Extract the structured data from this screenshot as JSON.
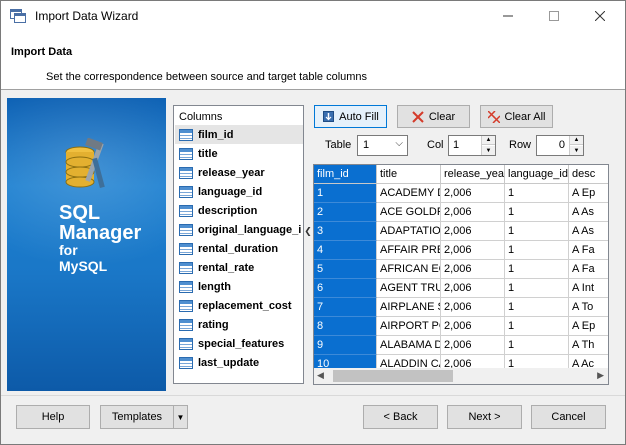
{
  "window": {
    "title": "Import Data Wizard",
    "minimize_icon": "minimize-icon",
    "maximize_icon": "maximize-icon",
    "close_icon": "close-icon"
  },
  "header": {
    "title": "Import Data",
    "subtitle": "Set the correspondence between source and target table columns"
  },
  "banner": {
    "line1": "SQL",
    "line2": "Manager",
    "line3": "for",
    "line4": "MySQL"
  },
  "columns": {
    "header": "Columns",
    "items": [
      "film_id",
      "title",
      "release_year",
      "language_id",
      "description",
      "original_language_i",
      "rental_duration",
      "rental_rate",
      "length",
      "replacement_cost",
      "rating",
      "special_features",
      "last_update"
    ],
    "selected": "film_id"
  },
  "toolbar": {
    "auto_fill": "Auto Fill",
    "clear": "Clear",
    "clear_all": "Clear All",
    "table_label": "Table",
    "table_value": "1",
    "col_label": "Col",
    "col_value": "1",
    "row_label": "Row",
    "row_value": "0"
  },
  "grid": {
    "headers": [
      "film_id",
      "title",
      "release_yea",
      "language_id",
      "desc"
    ],
    "rows": [
      [
        "1",
        "ACADEMY D",
        "2,006",
        "1",
        "A Ep"
      ],
      [
        "2",
        "ACE GOLDF",
        "2,006",
        "1",
        "A As"
      ],
      [
        "3",
        "ADAPTATIO",
        "2,006",
        "1",
        "A As"
      ],
      [
        "4",
        "AFFAIR PRE",
        "2,006",
        "1",
        "A Fa"
      ],
      [
        "5",
        "AFRICAN EG",
        "2,006",
        "1",
        "A Fa"
      ],
      [
        "6",
        "AGENT TRU",
        "2,006",
        "1",
        "A Int"
      ],
      [
        "7",
        "AIRPLANE S",
        "2,006",
        "1",
        "A To"
      ],
      [
        "8",
        "AIRPORT PC",
        "2,006",
        "1",
        "A Ep"
      ],
      [
        "9",
        "ALABAMA D",
        "2,006",
        "1",
        "A Th"
      ],
      [
        "10",
        "ALADDIN CA",
        "2,006",
        "1",
        "A Ac"
      ]
    ]
  },
  "footer": {
    "help": "Help",
    "templates": "Templates",
    "back": "< Back",
    "next": "Next >",
    "cancel": "Cancel"
  },
  "colors": {
    "selection": "#0a6fd0",
    "banner": "#1b7fd0"
  }
}
